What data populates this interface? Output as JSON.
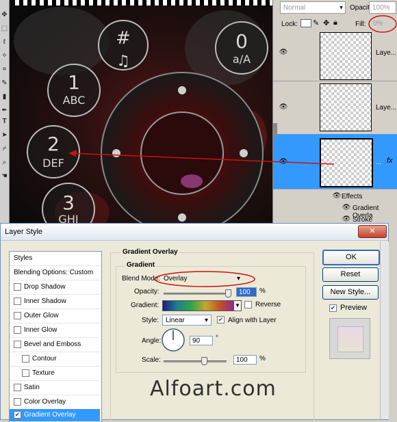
{
  "toolbar": {
    "tool_icons": [
      "move-icon",
      "marquee-icon",
      "lasso-icon",
      "magic-wand-icon",
      "crop-icon",
      "brush-icon",
      "gradient-icon",
      "pen-icon",
      "type-icon",
      "path-icon",
      "eyedropper-icon",
      "zoom-icon",
      "hand-icon"
    ]
  },
  "dial": {
    "keys": [
      {
        "main": "#",
        "sub": "♫"
      },
      {
        "main": "0",
        "sub": "a/A"
      },
      {
        "main": "1",
        "sub": "ABC"
      },
      {
        "main": "2",
        "sub": "DEF"
      },
      {
        "main": "3",
        "sub": "GHI"
      }
    ]
  },
  "layers_panel": {
    "blend_mode": "Normal",
    "opacity_label": "Opacity:",
    "opacity_value": "100%",
    "lock_label": "Lock:",
    "fill_label": "Fill:",
    "fill_value": "0%",
    "layers": [
      {
        "name": "Laye...",
        "selected": false
      },
      {
        "name": "Laye...",
        "selected": false
      },
      {
        "name": "...",
        "selected": true,
        "fx": "fx"
      }
    ],
    "effects_label": "Effects",
    "effects": [
      "Gradient Overla",
      "Stroke"
    ]
  },
  "dialog": {
    "title": "Layer Style",
    "close_glyph": "✕",
    "styles_list": {
      "header": "Styles",
      "blending": "Blending Options: Custom",
      "items": [
        {
          "label": "Drop Shadow",
          "checked": false
        },
        {
          "label": "Inner Shadow",
          "checked": false
        },
        {
          "label": "Outer Glow",
          "checked": false
        },
        {
          "label": "Inner Glow",
          "checked": false
        },
        {
          "label": "Bevel and Emboss",
          "checked": false
        },
        {
          "label": "Contour",
          "checked": false
        },
        {
          "label": "Texture",
          "checked": false
        },
        {
          "label": "Satin",
          "checked": false
        },
        {
          "label": "Color Overlay",
          "checked": false
        },
        {
          "label": "Gradient Overlay",
          "checked": true
        }
      ]
    },
    "section_title": "Gradient Overlay",
    "group_title": "Gradient",
    "blend_mode_label": "Blend Mode:",
    "blend_mode_value": "Overlay",
    "opacity_label": "Opacity:",
    "opacity_value": "100",
    "gradient_label": "Gradient:",
    "reverse_label": "Reverse",
    "style_label": "Style:",
    "style_value": "Linear",
    "align_label": "Align with Layer",
    "angle_label": "Angle:",
    "angle_value": "90",
    "degree": "°",
    "scale_label": "Scale:",
    "scale_value": "100",
    "percent": "%",
    "buttons": {
      "ok": "OK",
      "reset": "Reset",
      "new_style": "New Style...",
      "preview": "Preview"
    },
    "watermark": "Alfoart.com",
    "colors": {
      "accent": "#3399ff",
      "annotation": "#cc1111"
    }
  }
}
